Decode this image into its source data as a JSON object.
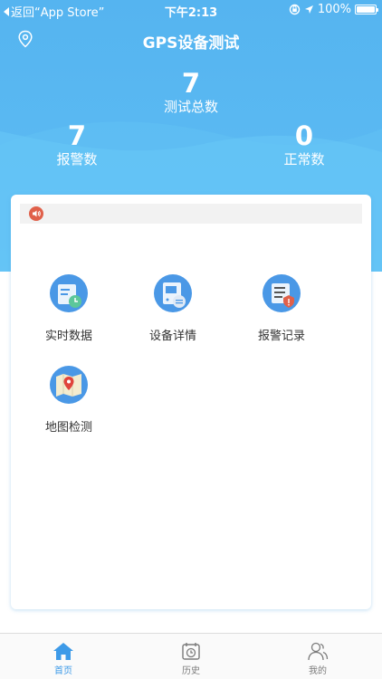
{
  "status_bar": {
    "back_text": "返回“App Store”",
    "time": "下午2:13",
    "battery_text": "100%"
  },
  "header": {
    "title": "GPS设备测试"
  },
  "stats": {
    "total": {
      "value": "7",
      "label": "测试总数"
    },
    "alarm": {
      "value": "7",
      "label": "报警数"
    },
    "normal": {
      "value": "0",
      "label": "正常数"
    }
  },
  "menu": {
    "items": [
      {
        "label": "实时数据",
        "icon": "realtime-data-icon"
      },
      {
        "label": "设备详情",
        "icon": "device-detail-icon"
      },
      {
        "label": "报警记录",
        "icon": "alarm-record-icon"
      },
      {
        "label": "地图检测",
        "icon": "map-detect-icon"
      }
    ]
  },
  "tabs": [
    {
      "label": "首页",
      "icon": "home-icon",
      "active": true
    },
    {
      "label": "历史",
      "icon": "history-icon",
      "active": false
    },
    {
      "label": "我的",
      "icon": "profile-icon",
      "active": false
    }
  ],
  "colors": {
    "primary": "#3d9ae8",
    "header": "#55b4f0",
    "notice_icon": "#e0604a"
  }
}
